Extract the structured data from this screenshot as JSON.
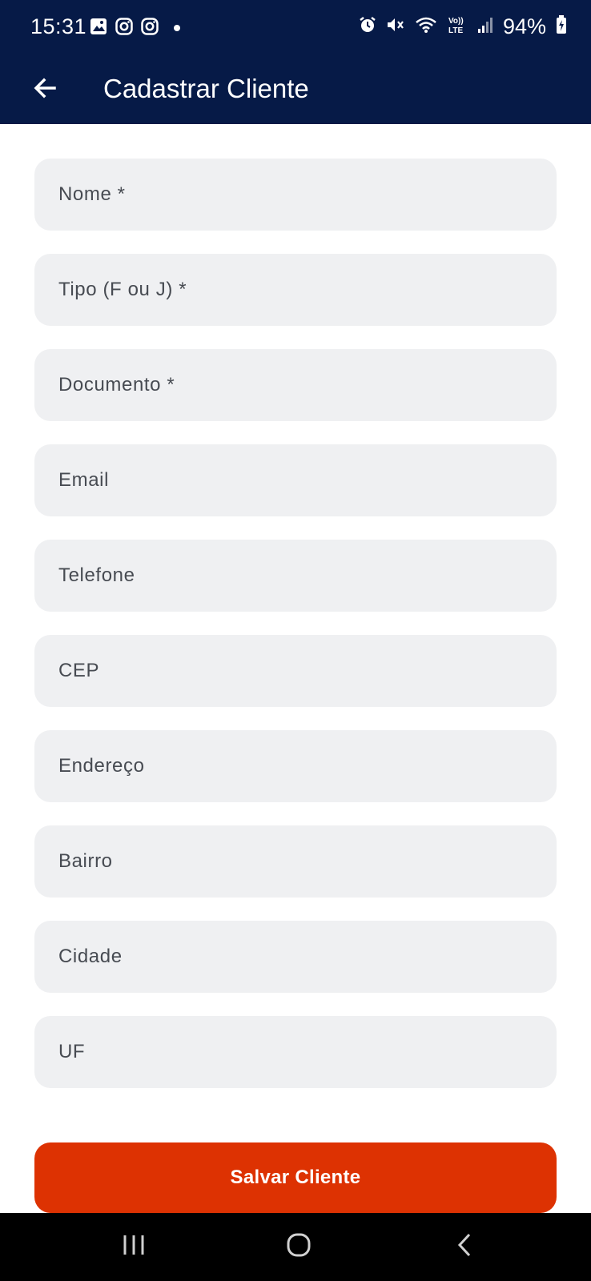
{
  "status_bar": {
    "time": "15:31",
    "battery_text": "94%",
    "left_icons": [
      "gallery-icon",
      "instagram-icon",
      "instagram-icon",
      "dot-icon"
    ],
    "right_icons": [
      "alarm-icon",
      "mute-icon",
      "wifi-icon",
      "volte-icon",
      "signal-icon",
      "battery-charging-icon"
    ]
  },
  "app_bar": {
    "title": "Cadastrar Cliente",
    "back_icon": "arrow-left-icon",
    "background": "#061a47"
  },
  "form": {
    "fields": [
      {
        "name": "nome",
        "placeholder": "Nome *",
        "value": ""
      },
      {
        "name": "tipo",
        "placeholder": "Tipo (F ou J) *",
        "value": ""
      },
      {
        "name": "documento",
        "placeholder": "Documento *",
        "value": ""
      },
      {
        "name": "email",
        "placeholder": "Email",
        "value": ""
      },
      {
        "name": "telefone",
        "placeholder": "Telefone",
        "value": ""
      },
      {
        "name": "cep",
        "placeholder": "CEP",
        "value": ""
      },
      {
        "name": "endereco",
        "placeholder": "Endereço",
        "value": ""
      },
      {
        "name": "bairro",
        "placeholder": "Bairro",
        "value": ""
      },
      {
        "name": "cidade",
        "placeholder": "Cidade",
        "value": ""
      },
      {
        "name": "uf",
        "placeholder": "UF",
        "value": ""
      }
    ],
    "field_background": "#eff0f2"
  },
  "actions": {
    "save_label": "Salvar Cliente",
    "save_color": "#dd3202"
  },
  "nav_bar": {
    "buttons": [
      "recent-apps-icon",
      "home-icon",
      "back-icon"
    ]
  }
}
